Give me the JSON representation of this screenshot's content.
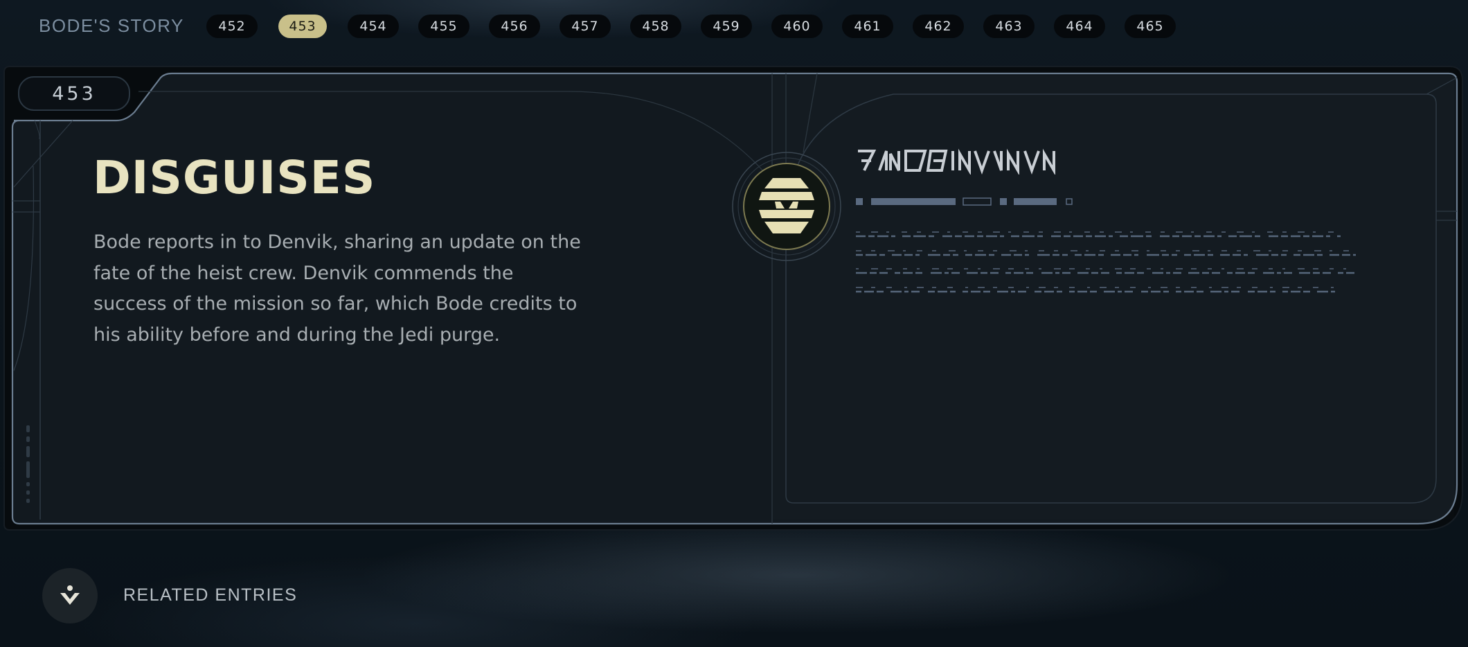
{
  "header": {
    "story_title": "BODE'S STORY",
    "entries": [
      "452",
      "453",
      "454",
      "455",
      "456",
      "457",
      "458",
      "459",
      "460",
      "461",
      "462",
      "463",
      "464",
      "465"
    ],
    "active_entry": "453"
  },
  "entry": {
    "number": "453",
    "title": "DISGUISES",
    "body": "Bode reports in to Denvik, sharing an update on the fate of the heist crew. Denvik commends the success of the mission so far, which Bode credits to his ability before and during the Jedi purge.",
    "emblem_icon": "faction-emblem-icon"
  },
  "related": {
    "label": "RELATED ENTRIES",
    "icon": "related-entries-icon"
  },
  "colors": {
    "accent": "#c9c08a",
    "title": "#e8e3c0",
    "body_text": "#a8aeb2",
    "aurebesh": "#5c6d83",
    "panel_border": "#6b7d90"
  }
}
